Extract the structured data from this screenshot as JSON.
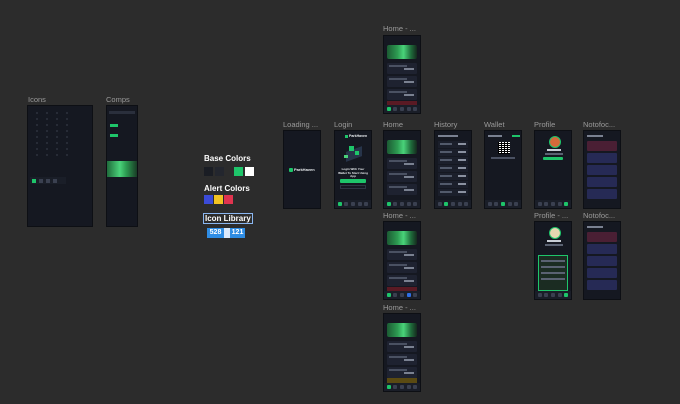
{
  "frames": {
    "icons": "Icons",
    "comps": "Comps",
    "loading": "Loading ...",
    "login": "Login",
    "home": "Home",
    "home_top": "Home - ...",
    "home_mid": "Home - ...",
    "home_bot": "Home - ...",
    "history": "History",
    "wallet": "Wallet",
    "profile": "Profile",
    "profile_2": "Profile - ...",
    "notif_1": "Notofoc...",
    "notif_2": "Notofoc..."
  },
  "styleguide": {
    "base_colors_title": "Base Colors",
    "base_colors": [
      "#1a1d24",
      "#23262e",
      "#1ec56a",
      "#ffffff"
    ],
    "alert_colors_title": "Alert Colors",
    "alert_colors": [
      "#3b4bd8",
      "#f2c322",
      "#e0344f"
    ],
    "icon_library_title": "Icon Library",
    "icon_count_a": "528",
    "icon_count_b": "121"
  },
  "app": {
    "brand": "ParkHaven",
    "login_heading": "Login With Your Wallet To Start Using App"
  },
  "colors": {
    "canvas_bg": "#2c2c2c",
    "frame_bg": "#151821",
    "accent_green": "#1ec56a",
    "badge_blue": "#2f8de4"
  }
}
